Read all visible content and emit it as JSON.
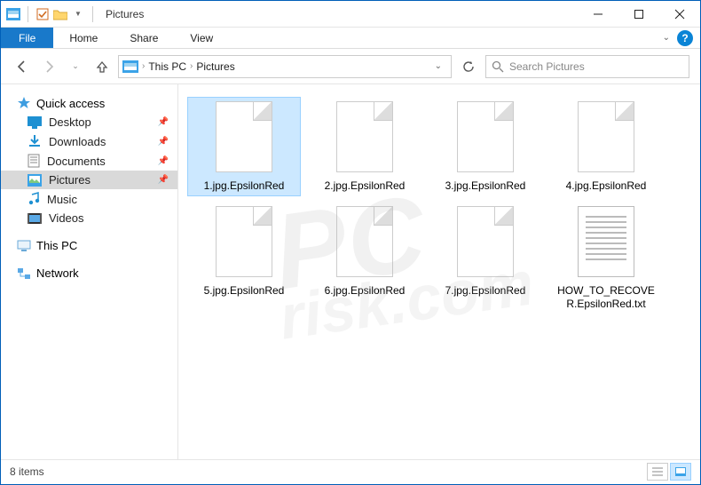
{
  "titlebar": {
    "title": "Pictures"
  },
  "ribbon": {
    "file": "File",
    "home": "Home",
    "share": "Share",
    "view": "View"
  },
  "nav": {
    "breadcrumb": [
      "This PC",
      "Pictures"
    ]
  },
  "search": {
    "placeholder": "Search Pictures"
  },
  "sidebar": {
    "quick_access": "Quick access",
    "items": [
      {
        "label": "Desktop",
        "icon": "desktop",
        "pinned": true
      },
      {
        "label": "Downloads",
        "icon": "downloads",
        "pinned": true
      },
      {
        "label": "Documents",
        "icon": "documents",
        "pinned": true
      },
      {
        "label": "Pictures",
        "icon": "pictures",
        "pinned": true,
        "selected": true
      },
      {
        "label": "Music",
        "icon": "music",
        "pinned": false
      },
      {
        "label": "Videos",
        "icon": "videos",
        "pinned": false
      }
    ],
    "this_pc": "This PC",
    "network": "Network"
  },
  "files": [
    {
      "name": "1.jpg.EpsilonRed",
      "type": "blank",
      "selected": true
    },
    {
      "name": "2.jpg.EpsilonRed",
      "type": "blank"
    },
    {
      "name": "3.jpg.EpsilonRed",
      "type": "blank"
    },
    {
      "name": "4.jpg.EpsilonRed",
      "type": "blank"
    },
    {
      "name": "5.jpg.EpsilonRed",
      "type": "blank"
    },
    {
      "name": "6.jpg.EpsilonRed",
      "type": "blank"
    },
    {
      "name": "7.jpg.EpsilonRed",
      "type": "blank"
    },
    {
      "name": "HOW_TO_RECOVER.EpsilonRed.txt",
      "type": "txt"
    }
  ],
  "status": {
    "count_label": "8 items"
  },
  "watermark": {
    "line1": "PC",
    "line2": "risk.com"
  }
}
